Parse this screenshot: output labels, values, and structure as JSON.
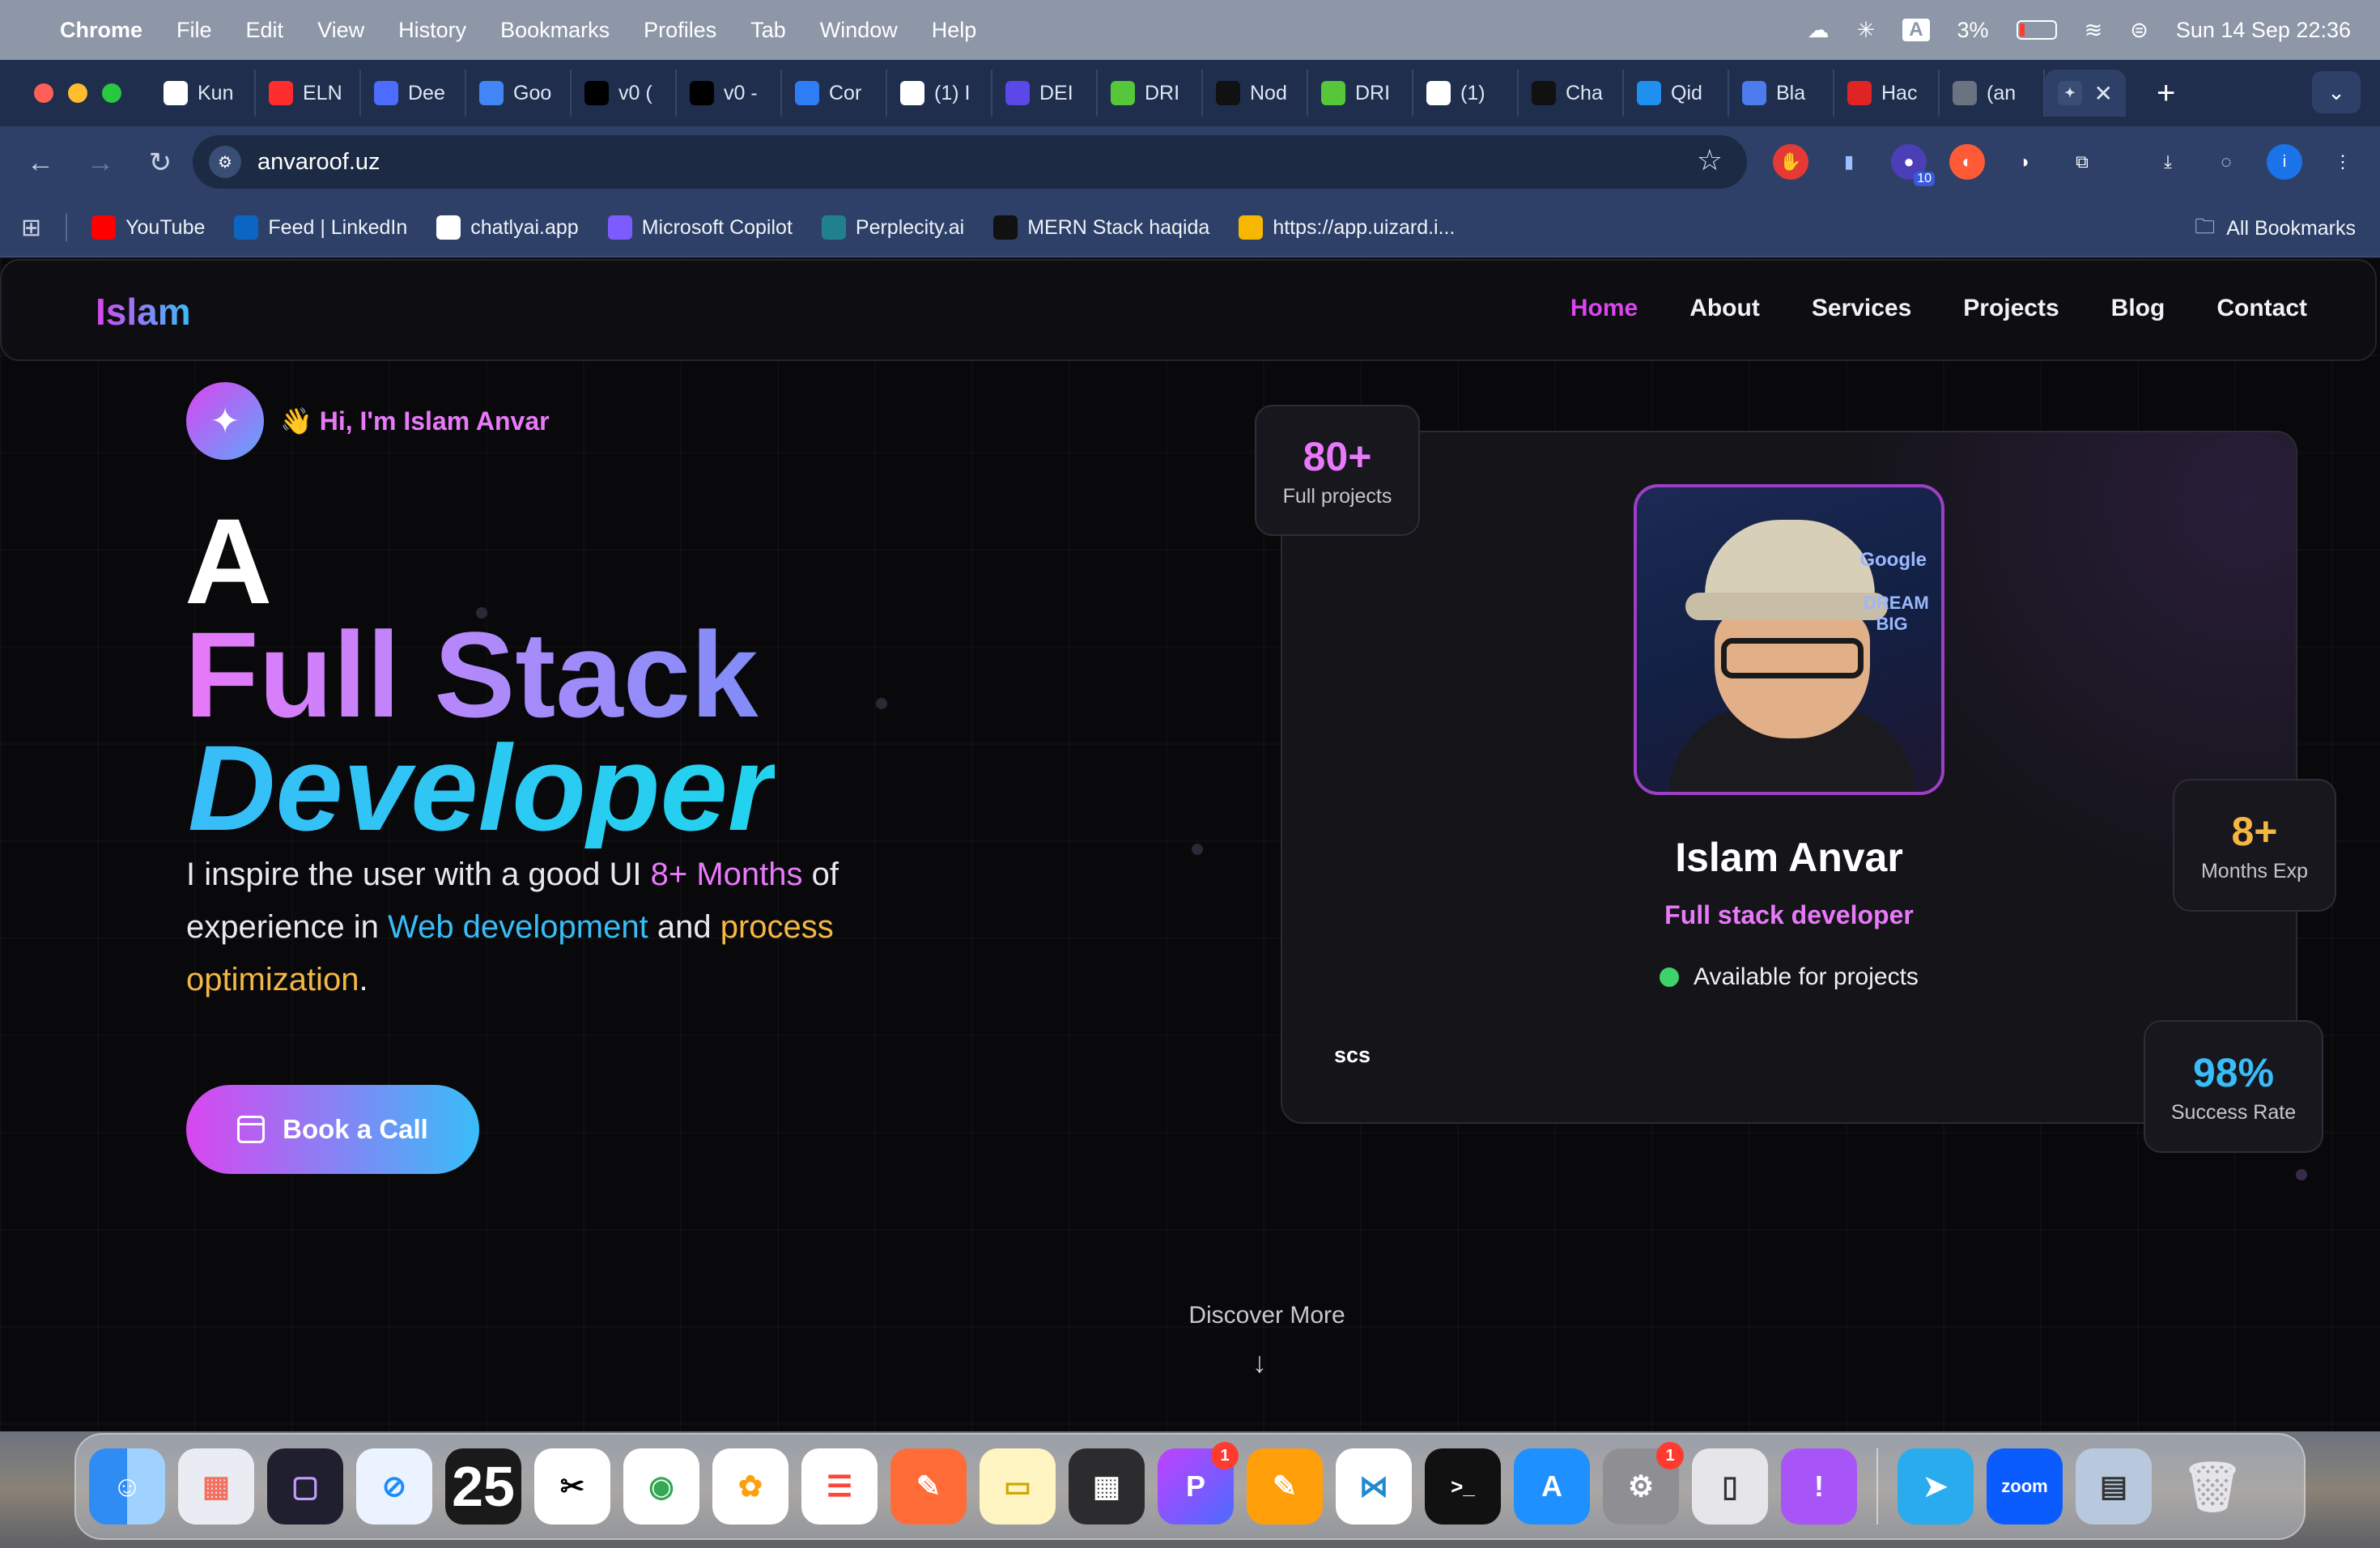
{
  "menubar": {
    "app": "Chrome",
    "items": [
      "File",
      "Edit",
      "View",
      "History",
      "Bookmarks",
      "Profiles",
      "Tab",
      "Window",
      "Help"
    ],
    "datetime": "Sun 14 Sep  22:36",
    "battery": "3%",
    "input": "A"
  },
  "tabs": [
    {
      "label": "Kun",
      "color": "#ffffff"
    },
    {
      "label": "ELN",
      "color": "#ff2d2d"
    },
    {
      "label": "Dee",
      "color": "#4d6bfe"
    },
    {
      "label": "Goo",
      "color": "#4285f4"
    },
    {
      "label": "v0 (",
      "color": "#000000"
    },
    {
      "label": "v0 -",
      "color": "#000000"
    },
    {
      "label": "Cor",
      "color": "#2f7df6"
    },
    {
      "label": "(1) I",
      "color": "#ffffff"
    },
    {
      "label": "DEI",
      "color": "#5b48e8"
    },
    {
      "label": "DRI",
      "color": "#56c73b"
    },
    {
      "label": "Nod",
      "color": "#111111"
    },
    {
      "label": "DRI",
      "color": "#56c73b"
    },
    {
      "label": "(1)",
      "color": "#ffffff"
    },
    {
      "label": "Cha",
      "color": "#111111"
    },
    {
      "label": "Qid",
      "color": "#1f8ff0"
    },
    {
      "label": "Bla",
      "color": "#4b7bec"
    },
    {
      "label": "Hac",
      "color": "#e02424"
    },
    {
      "label": "(an",
      "color": "#6b7280"
    }
  ],
  "address": "anvaroof.uz",
  "extensions": {
    "badge": "10"
  },
  "bookmarks": [
    {
      "label": "YouTube",
      "color": "#ff0000"
    },
    {
      "label": "Feed | LinkedIn",
      "color": "#0a66c2"
    },
    {
      "label": "chatlyai.app",
      "color": "#ffffff"
    },
    {
      "label": "Microsoft Copilot",
      "color": "#7c5cff"
    },
    {
      "label": "Perplecity.ai",
      "color": "#20808d"
    },
    {
      "label": "MERN Stack haqida",
      "color": "#111111"
    },
    {
      "label": "https://app.uizard.i...",
      "color": "#f5b700"
    }
  ],
  "all_bookmarks": "All Bookmarks",
  "site": {
    "logo": "Islam",
    "nav": [
      "Home",
      "About",
      "Services",
      "Projects",
      "Blog",
      "Contact"
    ],
    "greeting": "👋 Hi, I'm Islam Anvar",
    "headline_a": "A",
    "headline_fs": "Full Stack",
    "headline_dev": "Developer",
    "desc": {
      "p1": "I inspire the user with a good UI ",
      "months": "8+ Months",
      "p2": " of experience in ",
      "web": "Web development",
      "p3": " and ",
      "process": "process optimization",
      "p4": "."
    },
    "cta": "Book a Call",
    "profile": {
      "name": "Islam Anvar",
      "role": "Full stack developer",
      "status": "Available for projects",
      "tag": "scs",
      "avatar_text1": "Google",
      "avatar_text2": "DREAM BIG"
    },
    "stats": [
      {
        "num": "80+",
        "label": "Full projects",
        "color": "#e879f9"
      },
      {
        "num": "8+",
        "label": "Months Exp",
        "color": "#f5b742"
      },
      {
        "num": "98%",
        "label": "Success Rate",
        "color": "#38bdf8"
      }
    ],
    "discover": "Discover More"
  },
  "dock": {
    "calendar_day": "25",
    "badges": [
      "1",
      "1"
    ]
  }
}
